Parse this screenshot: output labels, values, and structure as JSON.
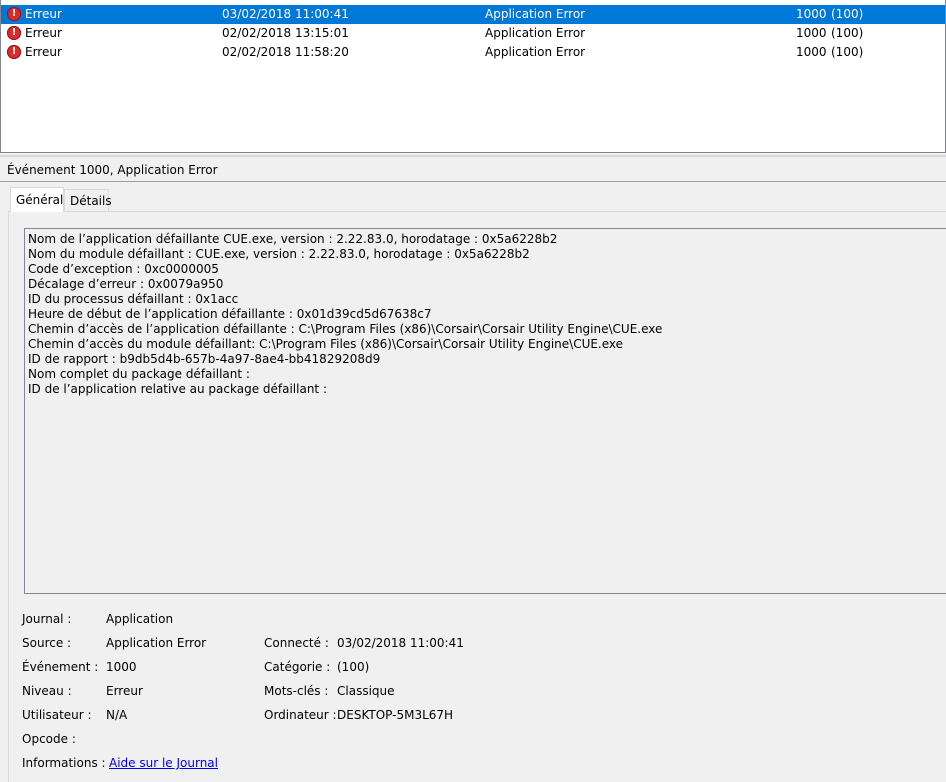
{
  "events": [
    {
      "level": "Erreur",
      "date": "03/02/2018 11:00:41",
      "source": "Application Error",
      "id": "1000",
      "category": "(100)",
      "selected": true
    },
    {
      "level": "Erreur",
      "date": "02/02/2018 13:15:01",
      "source": "Application Error",
      "id": "1000",
      "category": "(100)",
      "selected": false
    },
    {
      "level": "Erreur",
      "date": "02/02/2018 11:58:20",
      "source": "Application Error",
      "id": "1000",
      "category": "(100)",
      "selected": false
    }
  ],
  "detail_title": "Événement 1000, Application Error",
  "tabs": {
    "general": "Général",
    "details": "Détails"
  },
  "description": [
    "Nom de l’application défaillante CUE.exe, version : 2.22.83.0, horodatage : 0x5a6228b2",
    "Nom du module défaillant : CUE.exe, version : 2.22.83.0, horodatage : 0x5a6228b2",
    "Code d’exception : 0xc0000005",
    "Décalage d’erreur : 0x0079a950",
    "ID du processus défaillant : 0x1acc",
    "Heure de début de l’application défaillante : 0x01d39cd5d67638c7",
    "Chemin d’accès de l’application défaillante : C:\\Program Files (x86)\\Corsair\\Corsair Utility Engine\\CUE.exe",
    "Chemin d’accès du module défaillant: C:\\Program Files (x86)\\Corsair\\Corsair Utility Engine\\CUE.exe",
    "ID de rapport : b9db5d4b-657b-4a97-8ae4-bb41829208d9",
    "Nom complet du package défaillant :",
    "ID de l’application relative au package défaillant :"
  ],
  "meta": {
    "journal_label": "Journal :",
    "journal_value": "Application",
    "source_label": "Source :",
    "source_value": "Application Error",
    "connecte_label": "Connecté :",
    "connecte_value": "03/02/2018 11:00:41",
    "evenement_label": "Événement :",
    "evenement_value": "1000",
    "categorie_label": "Catégorie :",
    "categorie_value": "(100)",
    "niveau_label": "Niveau :",
    "niveau_value": "Erreur",
    "motscles_label": "Mots-clés :",
    "motscles_value": "Classique",
    "utilisateur_label": "Utilisateur :",
    "utilisateur_value": "N/A",
    "ordinateur_label": "Ordinateur :",
    "ordinateur_value": "DESKTOP-5M3L67H",
    "opcode_label": "Opcode :",
    "informations_label": "Informations :",
    "informations_link": "Aide sur le Journal"
  },
  "colors": {
    "selection": "#0078d7",
    "error_icon": "#d92b2b",
    "link": "#0000ee"
  }
}
